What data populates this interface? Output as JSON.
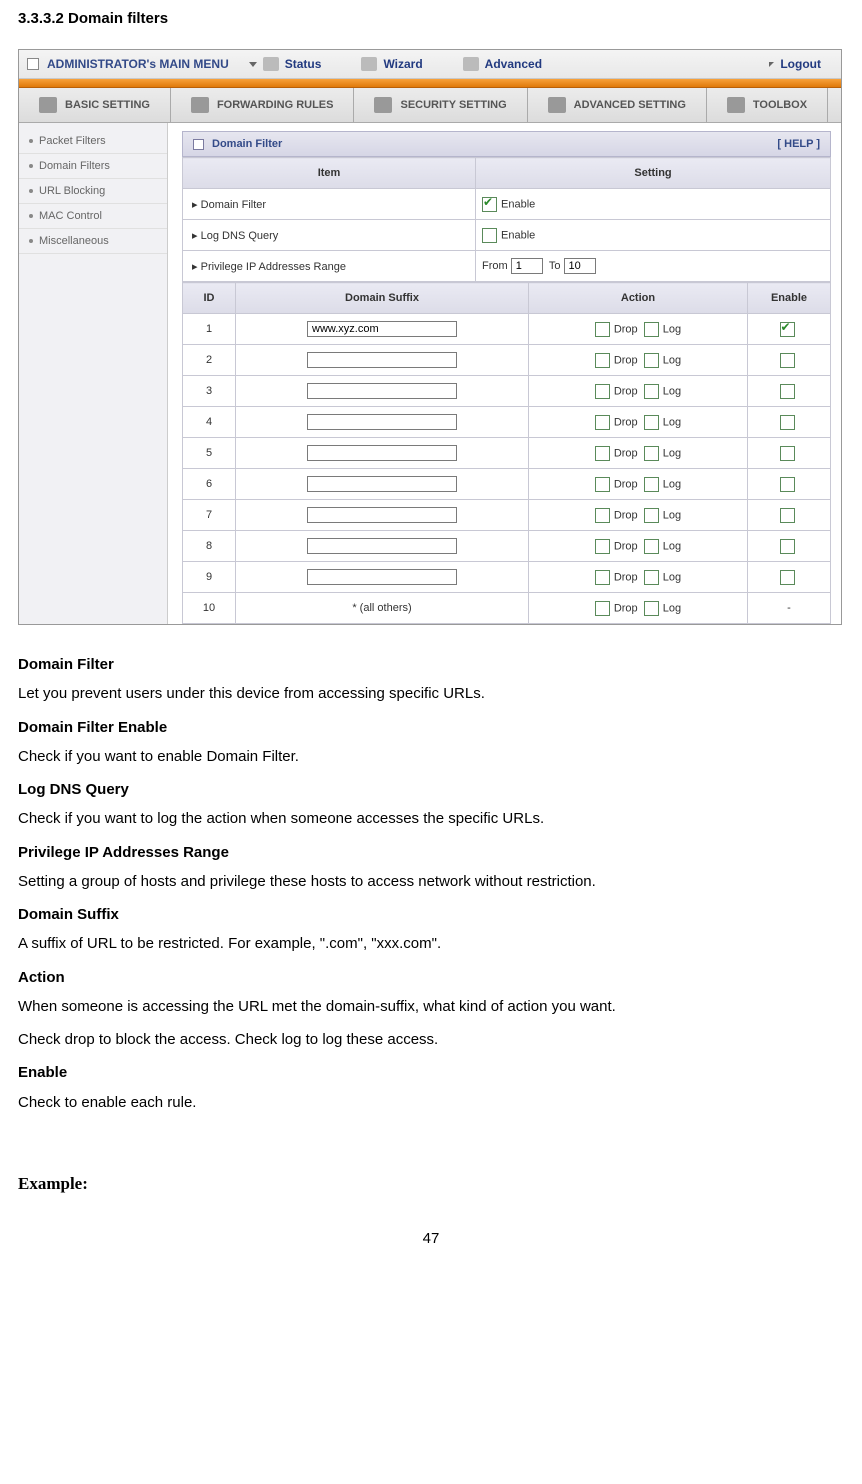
{
  "section_heading": "3.3.3.2 Domain filters",
  "menu": {
    "title": "ADMINISTRATOR's MAIN MENU",
    "items": [
      "Status",
      "Wizard",
      "Advanced"
    ],
    "logout": "Logout"
  },
  "tabs": [
    "BASIC SETTING",
    "FORWARDING RULES",
    "SECURITY SETTING",
    "ADVANCED SETTING",
    "TOOLBOX"
  ],
  "sidebar": [
    "Packet Filters",
    "Domain Filters",
    "URL Blocking",
    "MAC Control",
    "Miscellaneous"
  ],
  "panel": {
    "title": "Domain Filter",
    "help": "[ HELP ]",
    "header_item": "Item",
    "header_setting": "Setting",
    "rows": [
      {
        "label": "Domain Filter",
        "enable_label": "Enable",
        "checked": true
      },
      {
        "label": "Log DNS Query",
        "enable_label": "Enable",
        "checked": false
      }
    ],
    "privilege_label": "Privilege IP Addresses Range",
    "from_label": "From",
    "to_label": "To",
    "from_val": "1",
    "to_val": "10",
    "tbl_headers": {
      "id": "ID",
      "suffix": "Domain Suffix",
      "action": "Action",
      "enable": "Enable"
    },
    "action_drop": "Drop",
    "action_log": "Log",
    "entries": [
      {
        "id": "1",
        "suffix": "www.xyz.com",
        "enable": true
      },
      {
        "id": "2",
        "suffix": "",
        "enable": false
      },
      {
        "id": "3",
        "suffix": "",
        "enable": false
      },
      {
        "id": "4",
        "suffix": "",
        "enable": false
      },
      {
        "id": "5",
        "suffix": "",
        "enable": false
      },
      {
        "id": "6",
        "suffix": "",
        "enable": false
      },
      {
        "id": "7",
        "suffix": "",
        "enable": false
      },
      {
        "id": "8",
        "suffix": "",
        "enable": false
      },
      {
        "id": "9",
        "suffix": "",
        "enable": false
      }
    ],
    "last": {
      "id": "10",
      "suffix": "* (all others)",
      "enable": "-"
    }
  },
  "doc": {
    "h1": "Domain Filter",
    "p1": "Let you prevent users under this device from accessing specific URLs.",
    "h2": "Domain Filter Enable",
    "p2": "Check if you want to enable Domain Filter.",
    "h3": "Log DNS Query",
    "p3": "Check if you want to log the action when someone accesses the specific URLs.",
    "h4": "Privilege IP Addresses Range",
    "p4": "Setting a group of hosts and privilege these hosts to access network without restriction.",
    "h5": "Domain Suffix",
    "p5": "A suffix of URL to be restricted. For example, \".com\", \"xxx.com\".",
    "h6": "Action",
    "p6": "When someone is accessing the URL met the domain-suffix, what kind of action you want.",
    "p6b": "Check drop to block the access. Check log to log these access.",
    "h7": "Enable",
    "p7": "Check to enable each rule."
  },
  "example": "Example:",
  "page": "47"
}
